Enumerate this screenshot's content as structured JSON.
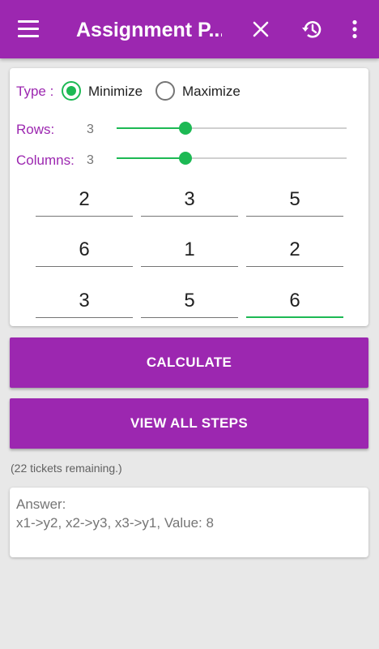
{
  "appbar": {
    "title": "Assignment P...",
    "icons": [
      "menu-icon",
      "close-icon",
      "history-icon",
      "more-vert-icon"
    ]
  },
  "type": {
    "label": "Type :",
    "options": [
      {
        "label": "Minimize",
        "checked": true
      },
      {
        "label": "Maximize",
        "checked": false
      }
    ]
  },
  "rows": {
    "label": "Rows:",
    "value": "3",
    "level_percent": 30
  },
  "columns": {
    "label": "Columns:",
    "value": "3",
    "level_percent": 30
  },
  "matrix": [
    [
      "2",
      "3",
      "5"
    ],
    [
      "6",
      "1",
      "2"
    ],
    [
      "3",
      "5",
      "6"
    ]
  ],
  "buttons": {
    "calculate": "CALCULATE",
    "view_steps": "VIEW ALL STEPS"
  },
  "tickets": "(22 tickets remaining.)",
  "answer": {
    "heading": "Answer:",
    "text": "x1->y2, x2->y3, x3->y1, Value: 8"
  },
  "colors": {
    "primary": "#9c27b0",
    "accent": "#1db954",
    "background": "#e8e8e8"
  }
}
